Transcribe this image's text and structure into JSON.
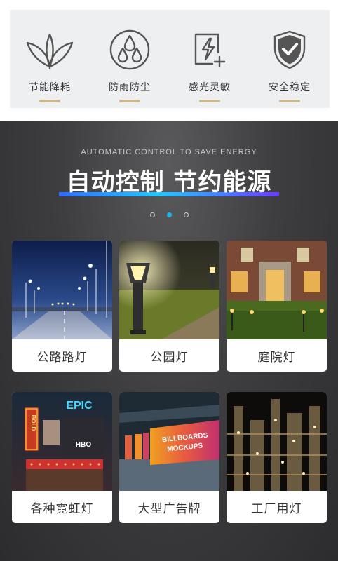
{
  "features": [
    {
      "label": "节能降耗",
      "icon": "leaf-icon"
    },
    {
      "label": "防雨防尘",
      "icon": "water-drops-icon"
    },
    {
      "label": "感光灵敏",
      "icon": "sensor-lightning-icon"
    },
    {
      "label": "安全稳定",
      "icon": "shield-check-icon"
    }
  ],
  "banner": {
    "subtitle": "AUTOMATIC CONTROL TO SAVE ENERGY",
    "headline": "自动控制 节约能源",
    "carousel_active_index": 1,
    "carousel_count": 3
  },
  "cards": [
    {
      "label": "公路路灯"
    },
    {
      "label": "公园灯"
    },
    {
      "label": "庭院灯"
    },
    {
      "label": "各种霓虹灯"
    },
    {
      "label": "大型广告牌"
    },
    {
      "label": "工厂用灯"
    }
  ],
  "image_text": {
    "neon_epic": "EPIC",
    "neon_bold": "BOLD",
    "neon_hbo": "HBO",
    "billboard_line1": "BILLBOARDS",
    "billboard_line2": "MOCKUPS"
  },
  "colors": {
    "accent_bar": "#c9b98a",
    "carousel_active": "#19b8e8",
    "underline_start": "#2f6bff",
    "underline_end": "#6a3cff"
  }
}
